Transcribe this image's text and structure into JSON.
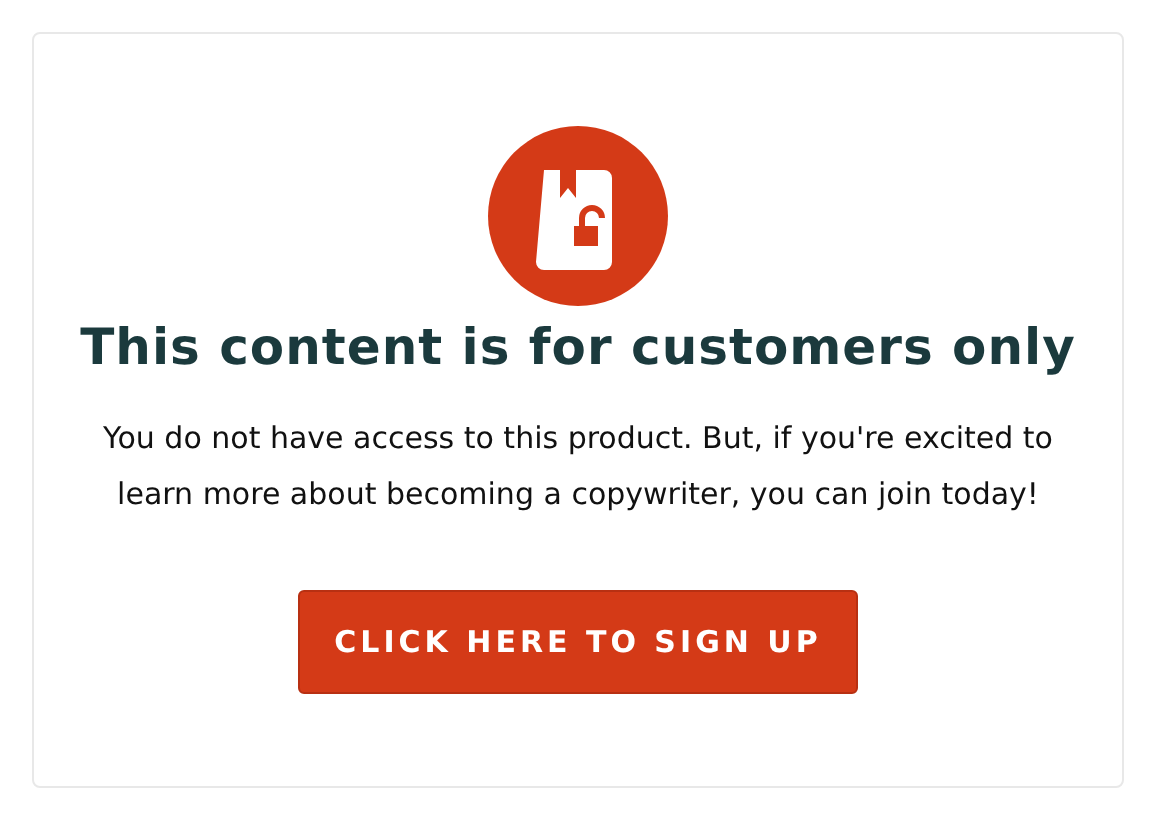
{
  "title": "This content is for customers only",
  "message": "You do not have access to this product. But, if you're excited to learn more about becoming a copywriter, you can join today!",
  "button": {
    "label": "CLICK HERE TO SIGN UP"
  }
}
